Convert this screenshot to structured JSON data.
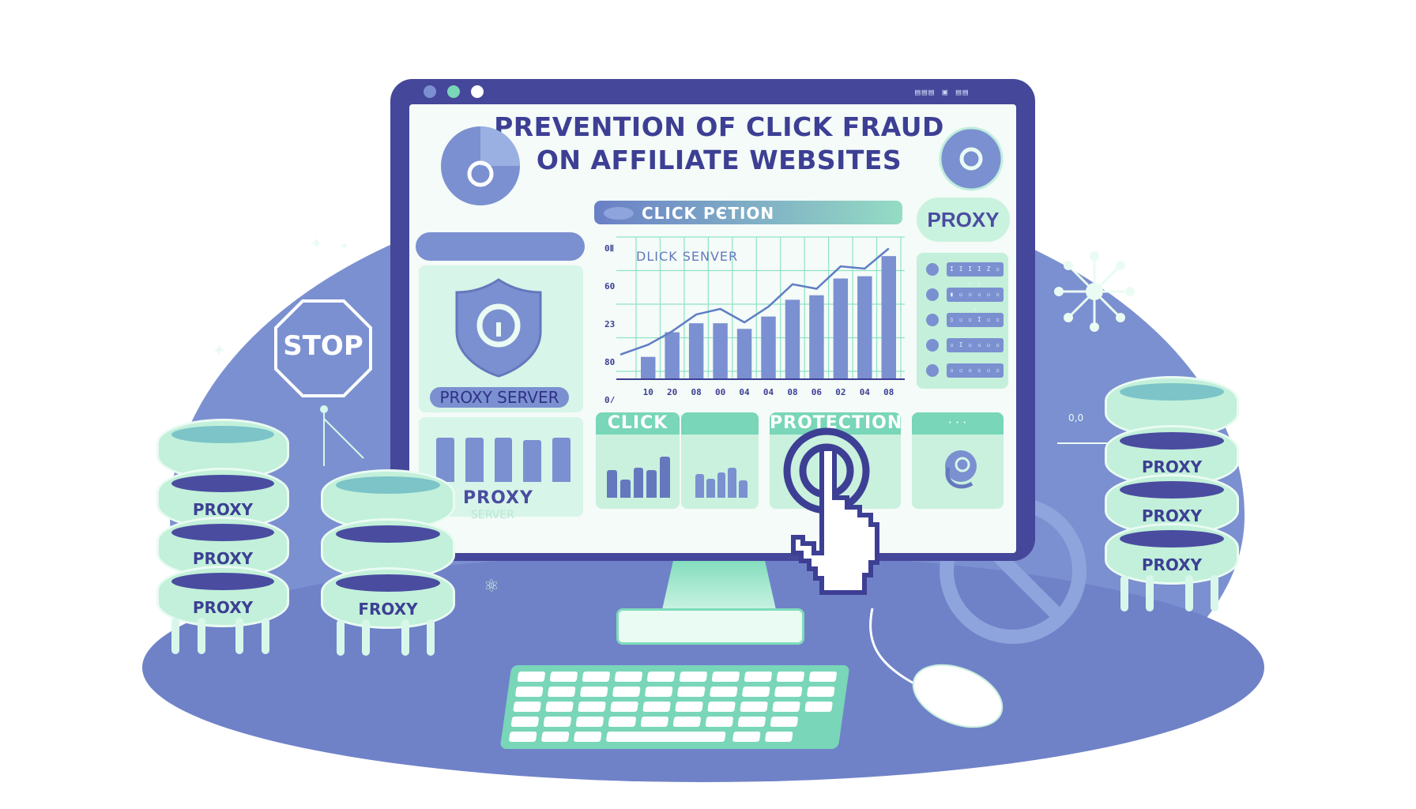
{
  "illustration": {
    "title_line1": "PREVENTION OF CLICK FRAUD",
    "title_line2": "ON AFFILIATE WEBSITES",
    "window_dots": [
      "#7b90d0",
      "#79d6b8",
      "#ffffff"
    ],
    "system_tray_text": "▤▤▤  ▣  ▤▤"
  },
  "colors": {
    "navy": "#45479a",
    "periwinkle": "#7b90d0",
    "mint": "#79d6b8",
    "mint_light": "#d7f5e8",
    "white": "#ffffff"
  },
  "panels": {
    "proxy_server_label": "PROXY SERVER",
    "proxy_server2_label": "PROXY",
    "proxy_server2_sublabel": "SERVER",
    "chart_header": "CLICK PЄTION",
    "chart_subtitle": "DLICK SENVER",
    "proxy_badge": "PROXY",
    "server_list": [
      "I I I I Z ▫ ▫ ▫",
      "▮ ▫ ▫ ▫ ▫ ▫ ▫",
      "▯ ▫ ▫ I ▫ ▫",
      "▫ I ▫ ▫ ▫ ▫",
      "▫ ▫ ▫ ▫ ▫ ▫"
    ],
    "mini_cards": [
      {
        "label": "CLICK"
      },
      {
        "label": ""
      },
      {
        "label": "PROTECTION"
      },
      {
        "label": "· · ·"
      }
    ]
  },
  "chart_data": {
    "type": "bar",
    "title": "DLICK SENVER",
    "yticks": [
      "0Ⅱ",
      "60",
      "23",
      "80",
      "0/"
    ],
    "categories": [
      "10",
      "20",
      "08",
      "00",
      "04",
      "04",
      "08",
      "06",
      "02",
      "04",
      "08"
    ],
    "values": [
      2.0,
      4.2,
      5.0,
      5.0,
      4.5,
      5.6,
      7.1,
      7.5,
      9.0,
      9.2,
      11.0
    ],
    "line_values": [
      2.8,
      4.0,
      5.5,
      6.0,
      4.8,
      6.2,
      8.2,
      7.8,
      9.8,
      9.6,
      11.4
    ],
    "ylim": [
      0,
      12
    ],
    "grid": true,
    "series": [
      {
        "name": "bars",
        "values": [
          2.0,
          4.2,
          5.0,
          5.0,
          4.5,
          5.6,
          7.1,
          7.5,
          9.0,
          9.2,
          11.0
        ]
      },
      {
        "name": "trend",
        "values": [
          2.8,
          4.0,
          5.5,
          6.0,
          4.8,
          6.2,
          8.2,
          7.8,
          9.8,
          9.6,
          11.4
        ]
      }
    ]
  },
  "mini_charts": {
    "click": [
      0.6,
      0.4,
      0.65,
      0.6,
      0.9
    ],
    "second": [
      0.55,
      0.45,
      0.6,
      0.7,
      0.4
    ],
    "proxy_bars": [
      0.9,
      0.9,
      0.9,
      0.85,
      0.9
    ]
  },
  "signs": {
    "stop": "STOP"
  },
  "servers": {
    "left_stack": [
      "PROXY",
      "PROXY",
      "PROXY"
    ],
    "middle_stack": [
      "FROXY"
    ],
    "right_stack": [
      "PROXY",
      "PROXY",
      "PROXY"
    ]
  },
  "decor": {
    "right_small_text": "0,0"
  }
}
